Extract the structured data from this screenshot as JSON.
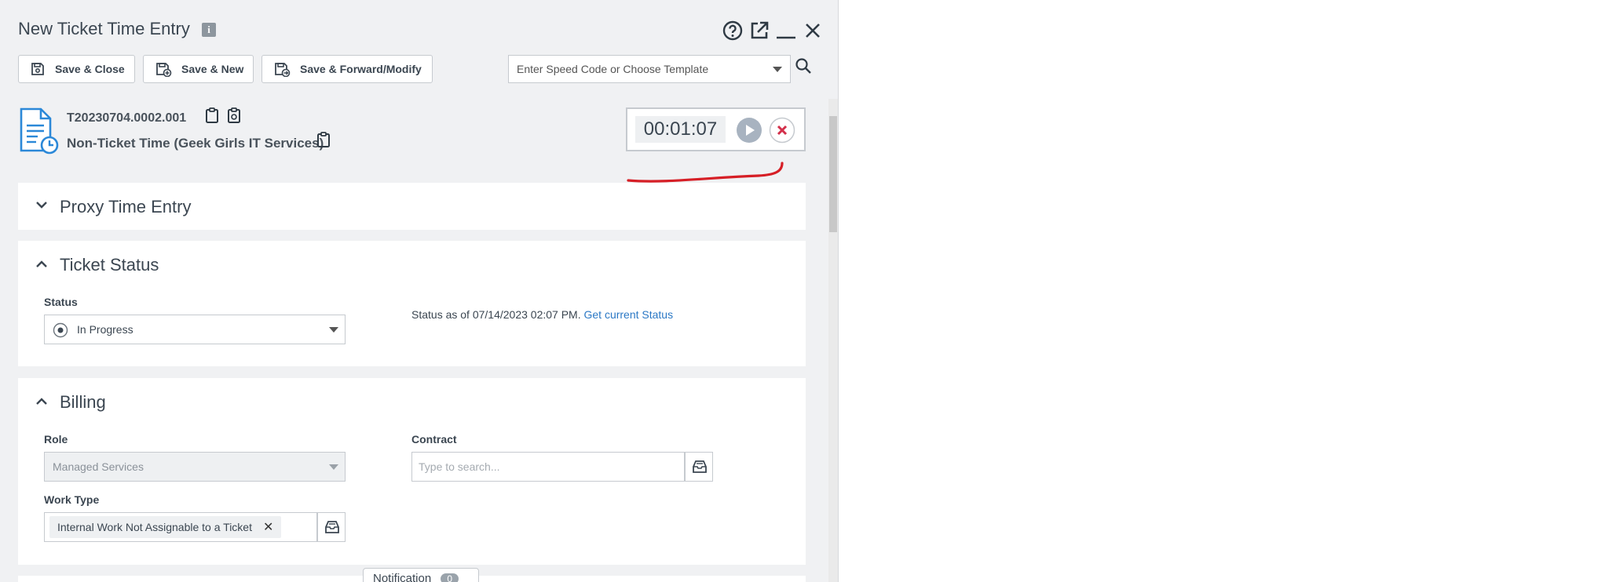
{
  "window": {
    "title": "New Ticket Time Entry"
  },
  "toolbar": {
    "save_close_label": "Save & Close",
    "save_new_label": "Save & New",
    "save_forward_label": "Save & Forward/Modify",
    "speed_code_placeholder": "Enter Speed Code or Choose Template"
  },
  "ticket": {
    "number": "T20230704.0002.001",
    "subtitle": "Non-Ticket Time (Geek Girls IT Services)"
  },
  "timer": {
    "value": "00:01:07"
  },
  "sections": {
    "proxy": {
      "title": "Proxy Time Entry"
    },
    "ticket_status": {
      "title": "Ticket Status",
      "status_label": "Status",
      "status_value": "In Progress",
      "status_note": "Status as of 07/14/2023 02:07 PM.",
      "status_link": "Get current Status"
    },
    "billing": {
      "title": "Billing",
      "role_label": "Role",
      "role_value": "Managed Services",
      "contract_label": "Contract",
      "contract_placeholder": "Type to search...",
      "work_type_label": "Work Type",
      "work_type_value": "Internal Work Not Assignable to a Ticket"
    }
  },
  "notification": {
    "label": "Notification",
    "count": "0"
  },
  "colors": {
    "accent_link": "#2b78c5",
    "annotation": "#d61f26",
    "cancel": "#d32f4a"
  }
}
